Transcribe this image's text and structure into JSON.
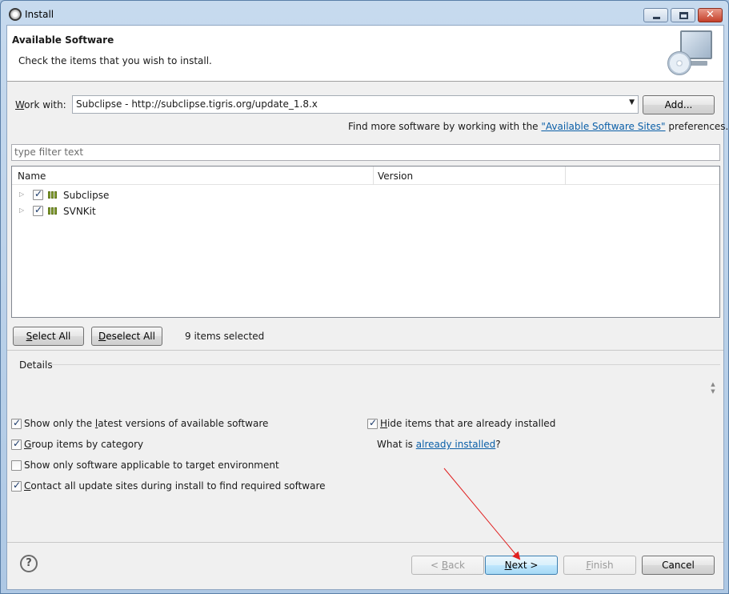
{
  "window": {
    "title": "Install",
    "controls": {
      "minimize": "minimize-icon",
      "maximize": "maximize-icon",
      "close": "close-icon",
      "close_glyph": "✕"
    }
  },
  "banner": {
    "title": "Available Software",
    "description": "Check the items that you wish to install."
  },
  "work_with": {
    "label": "Work with:",
    "value": "Subclipse - http://subclipse.tigris.org/update_1.8.x",
    "add_button": "Add..."
  },
  "more_software": {
    "prefix": "Find more software by working with the ",
    "link": "\"Available Software Sites\"",
    "suffix": " preferences."
  },
  "filter": {
    "placeholder": "type filter text"
  },
  "tree": {
    "columns": [
      "Name",
      "Version"
    ],
    "rows": [
      {
        "name": "Subclipse",
        "checked": true
      },
      {
        "name": "SVNKit",
        "checked": true
      }
    ]
  },
  "selection": {
    "select_all": "Select All",
    "deselect_all": "Deselect All",
    "status": "9 items selected"
  },
  "details": {
    "label": "Details"
  },
  "options": {
    "latest_versions": {
      "label": "Show only the latest versions of available software",
      "checked": true
    },
    "group_by_category": {
      "label": "Group items by category",
      "checked": true
    },
    "target_env": {
      "label": "Show only software applicable to target environment",
      "checked": false
    },
    "contact_sites": {
      "label": "Contact all update sites during install to find required software",
      "checked": true
    },
    "hide_installed": {
      "label": "Hide items that are already installed",
      "checked": true
    },
    "what_is": {
      "prefix": "What is ",
      "link": "already installed",
      "suffix": "?"
    }
  },
  "footer": {
    "help": "?",
    "back": "< Back",
    "next": "Next >",
    "finish": "Finish",
    "cancel": "Cancel"
  },
  "annotation": {
    "arrow_color": "#e02020"
  }
}
